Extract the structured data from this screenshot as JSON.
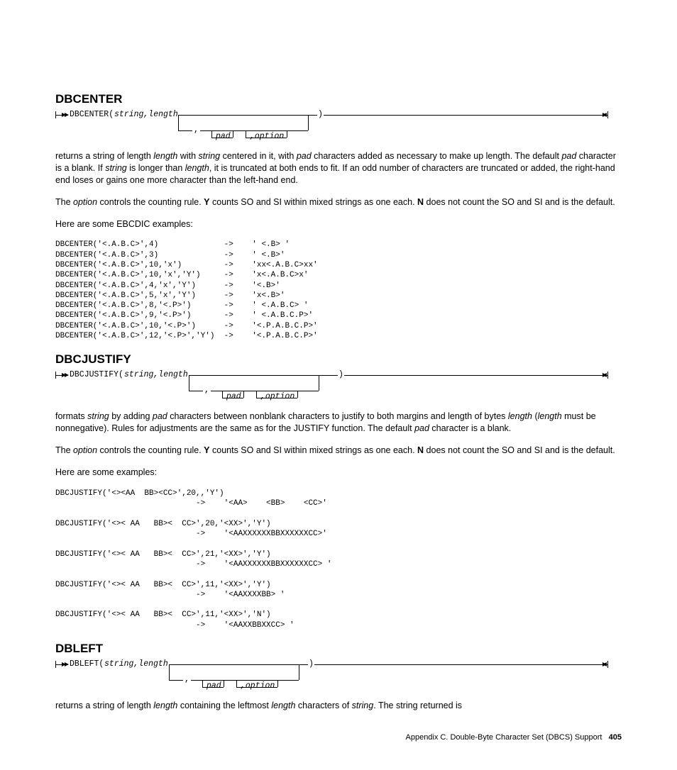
{
  "dbcenter": {
    "heading": "DBCENTER",
    "func": "DBCENTER(",
    "args": "string,length",
    "close": ")",
    "pad": "pad",
    "option": ",option",
    "para1_pre": "returns a string of length ",
    "para1_len": "length",
    "para1_mid1": " with ",
    "para1_str": "string",
    "para1_mid2": " centered in it, with ",
    "para1_pad": "pad",
    "para1_post": " characters added as necessary to make up length. The default ",
    "para1_pad2": "pad",
    "para1_post2": " character is a blank. If ",
    "para1_str2": "string",
    "para1_post3": " is longer than ",
    "para1_len2": "length",
    "para1_post4": ", it is truncated at both ends to fit. If an odd number of characters are truncated or added, the right-hand end loses or gains one more character than the left-hand end.",
    "para2_pre": "The ",
    "para2_opt": "option",
    "para2_mid": " controls the counting rule. ",
    "para2_y": "Y",
    "para2_mid2": " counts SO and SI within mixed strings as one each. ",
    "para2_n": "N",
    "para2_mid3": " does not count the SO and SI and is the default.",
    "exlead": "Here are some EBCDIC examples:",
    "examples": "DBCENTER('<.A.B.C>',4)              ->    ' <.B> '\nDBCENTER('<.A.B.C>',3)              ->    ' <.B>'\nDBCENTER('<.A.B.C>',10,'x')         ->    'xx<.A.B.C>xx'\nDBCENTER('<.A.B.C>',10,'x','Y')     ->    'x<.A.B.C>x'\nDBCENTER('<.A.B.C>',4,'x','Y')      ->    '<.B>'\nDBCENTER('<.A.B.C>',5,'x','Y')      ->    'x<.B>'\nDBCENTER('<.A.B.C>',8,'<.P>')       ->    ' <.A.B.C> '\nDBCENTER('<.A.B.C>',9,'<.P>')       ->    ' <.A.B.C.P>'\nDBCENTER('<.A.B.C>',10,'<.P>')      ->    '<.P.A.B.C.P>'\nDBCENTER('<.A.B.C>',12,'<.P>','Y')  ->    '<.P.A.B.C.P>'"
  },
  "dbcjustify": {
    "heading": "DBCJUSTIFY",
    "func": "DBCJUSTIFY(",
    "args": "string,length",
    "close": ")",
    "pad": "pad",
    "option": ",option",
    "para1_pre": "formats ",
    "para1_str": "string",
    "para1_mid1": " by adding ",
    "para1_pad": "pad",
    "para1_mid2": " characters between nonblank characters to justify to both margins and length of bytes ",
    "para1_len": "length",
    "para1_mid3": " (",
    "para1_len2": "length",
    "para1_mid4": " must be nonnegative). Rules for adjustments are the same as for the JUSTIFY function. The default ",
    "para1_pad2": "pad",
    "para1_post": " character is a blank.",
    "para2_pre": "The ",
    "para2_opt": "option",
    "para2_mid": " controls the counting rule. ",
    "para2_y": "Y",
    "para2_mid2": " counts SO and SI within mixed strings as one each. ",
    "para2_n": "N",
    "para2_mid3": " does not count the SO and SI and is the default.",
    "exlead": "Here are some examples:",
    "examples": "DBCJUSTIFY('<><AA  BB><CC>',20,,'Y')\n                              ->    '<AA>    <BB>    <CC>'\n\nDBCJUSTIFY('<>< AA   BB><  CC>',20,'<XX>','Y')\n                              ->    '<AAXXXXXXBBXXXXXXCC>'\n\nDBCJUSTIFY('<>< AA   BB><  CC>',21,'<XX>','Y')\n                              ->    '<AAXXXXXXBBXXXXXXCC> '\n\nDBCJUSTIFY('<>< AA   BB><  CC>',11,'<XX>','Y')\n                              ->    '<AAXXXXBB> '\n\nDBCJUSTIFY('<>< AA   BB><  CC>',11,'<XX>','N')\n                              ->    '<AAXXBBXXCC> '"
  },
  "dbleft": {
    "heading": "DBLEFT",
    "func": "DBLEFT(",
    "args": "string,length",
    "close": ")",
    "pad": "pad",
    "option": ",option",
    "para1_pre": "returns a string of length ",
    "para1_len": "length",
    "para1_mid": " containing the leftmost ",
    "para1_len2": "length",
    "para1_mid2": " characters of ",
    "para1_str": "string",
    "para1_post": ". The string returned is"
  },
  "footer": {
    "text": "Appendix C. Double-Byte Character Set (DBCS) Support",
    "page": "405"
  }
}
